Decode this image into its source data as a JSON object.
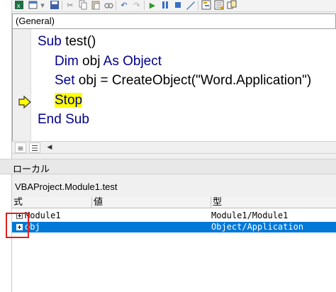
{
  "toolbar": {
    "icons": [
      "excel-icon",
      "insert-userform-icon",
      "dropdown-arrow-icon",
      "save-icon",
      "cut-icon",
      "copy-icon",
      "paste-icon",
      "find-icon",
      "undo-icon",
      "redo-icon",
      "run-icon",
      "break-icon",
      "reset-icon",
      "design-mode-icon",
      "project-explorer-icon",
      "properties-icon",
      "object-browser-icon"
    ]
  },
  "combo": {
    "value": "(General)"
  },
  "code": {
    "lines": [
      {
        "parts": [
          {
            "t": "Sub",
            "kw": true
          },
          {
            "t": " test()",
            "kw": false
          }
        ]
      },
      {
        "parts": [
          {
            "t": "Dim",
            "kw": true
          },
          {
            "t": " obj ",
            "kw": false
          },
          {
            "t": "As Object",
            "kw": true
          }
        ]
      },
      {
        "parts": [
          {
            "t": "Set",
            "kw": true
          },
          {
            "t": " obj = CreateObject(\"Word.Application\")",
            "kw": false
          }
        ]
      },
      {
        "parts": [
          {
            "t": "Stop",
            "kw": true,
            "hl": true
          }
        ]
      },
      {
        "parts": [
          {
            "t": "End Sub",
            "kw": true
          }
        ]
      }
    ],
    "current_line": 4,
    "colors": {
      "keyword": "#00008b",
      "highlight": "#ffff00",
      "arrow": "#ffff00"
    }
  },
  "view_buttons": [
    "procedure-view-icon",
    "full-module-view-icon"
  ],
  "locals": {
    "title": "ローカル",
    "context": "VBAProject.Module1.test",
    "columns": [
      "式",
      "値",
      "型"
    ],
    "rows": [
      {
        "expression": "Module1",
        "value": "",
        "type": "Module1/Module1",
        "selected": false
      },
      {
        "expression": "obj",
        "value": "",
        "type": "Object/Application",
        "selected": true
      }
    ],
    "colors": {
      "selected": "#0078d7",
      "annotation_box": "#e02020"
    }
  }
}
